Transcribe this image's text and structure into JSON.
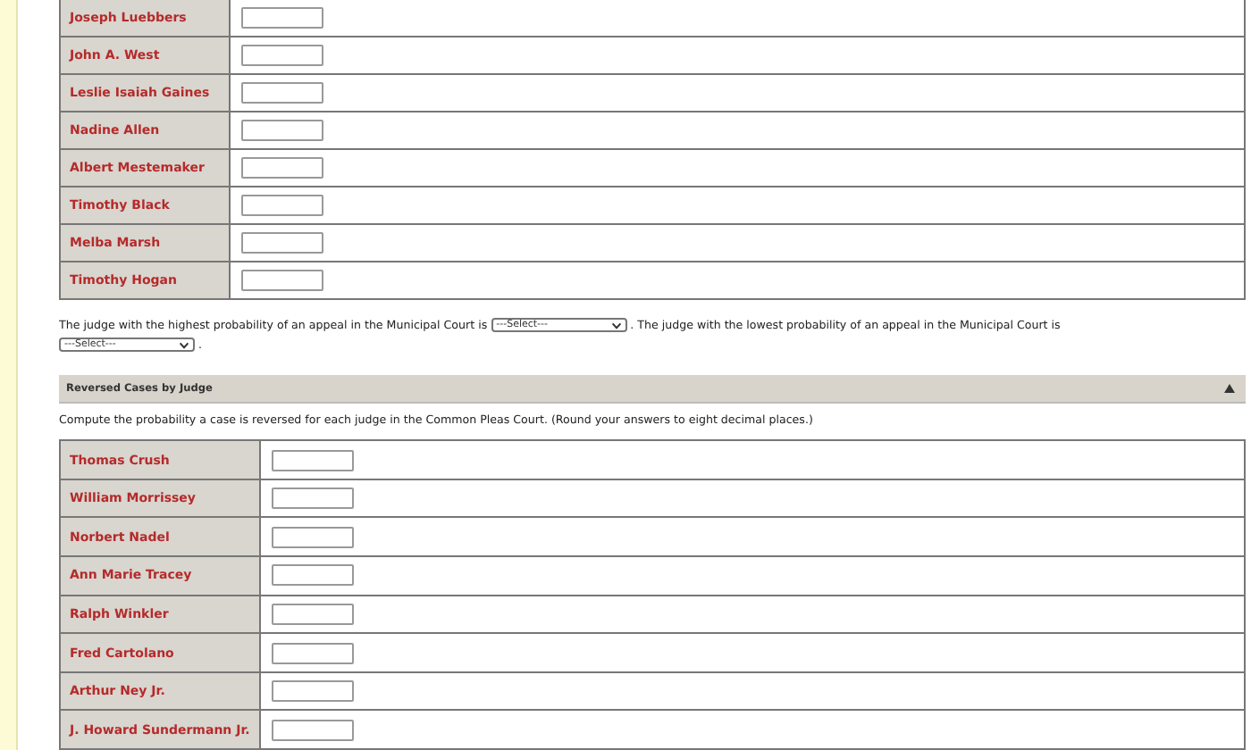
{
  "municipal_table": {
    "rows": [
      {
        "judge": "Joseph Luebbers",
        "answer": ""
      },
      {
        "judge": "John A. West",
        "answer": ""
      },
      {
        "judge": "Leslie Isaiah Gaines",
        "answer": ""
      },
      {
        "judge": "Nadine Allen",
        "answer": ""
      },
      {
        "judge": "Albert Mestemaker",
        "answer": ""
      },
      {
        "judge": "Timothy Black",
        "answer": ""
      },
      {
        "judge": "Melba Marsh",
        "answer": ""
      },
      {
        "judge": "Timothy Hogan",
        "answer": ""
      }
    ]
  },
  "sentence": {
    "part_1": "The judge with the highest probability of an appeal in the Municipal Court is",
    "select_1": "---Select---",
    "part_2": ". The judge with the lowest probability of an appeal in the Municipal Court is",
    "select_2": "---Select---",
    "part_3": "."
  },
  "section": {
    "title": "Reversed Cases by Judge",
    "expanded": true
  },
  "instruction": "Compute the probability a case is reversed for each judge in the Common Pleas Court. (Round your answers to eight decimal places.)",
  "common_pleas_table": {
    "rows": [
      {
        "judge": "Thomas Crush",
        "answer": ""
      },
      {
        "judge": "William Morrissey",
        "answer": ""
      },
      {
        "judge": "Norbert Nadel",
        "answer": ""
      },
      {
        "judge": "Ann Marie Tracey",
        "answer": ""
      },
      {
        "judge": "Ralph Winkler",
        "answer": ""
      },
      {
        "judge": "Fred Cartolano",
        "answer": ""
      },
      {
        "judge": "Arthur Ney Jr.",
        "answer": ""
      },
      {
        "judge": "J. Howard Sundermann Jr.",
        "answer": ""
      }
    ]
  }
}
